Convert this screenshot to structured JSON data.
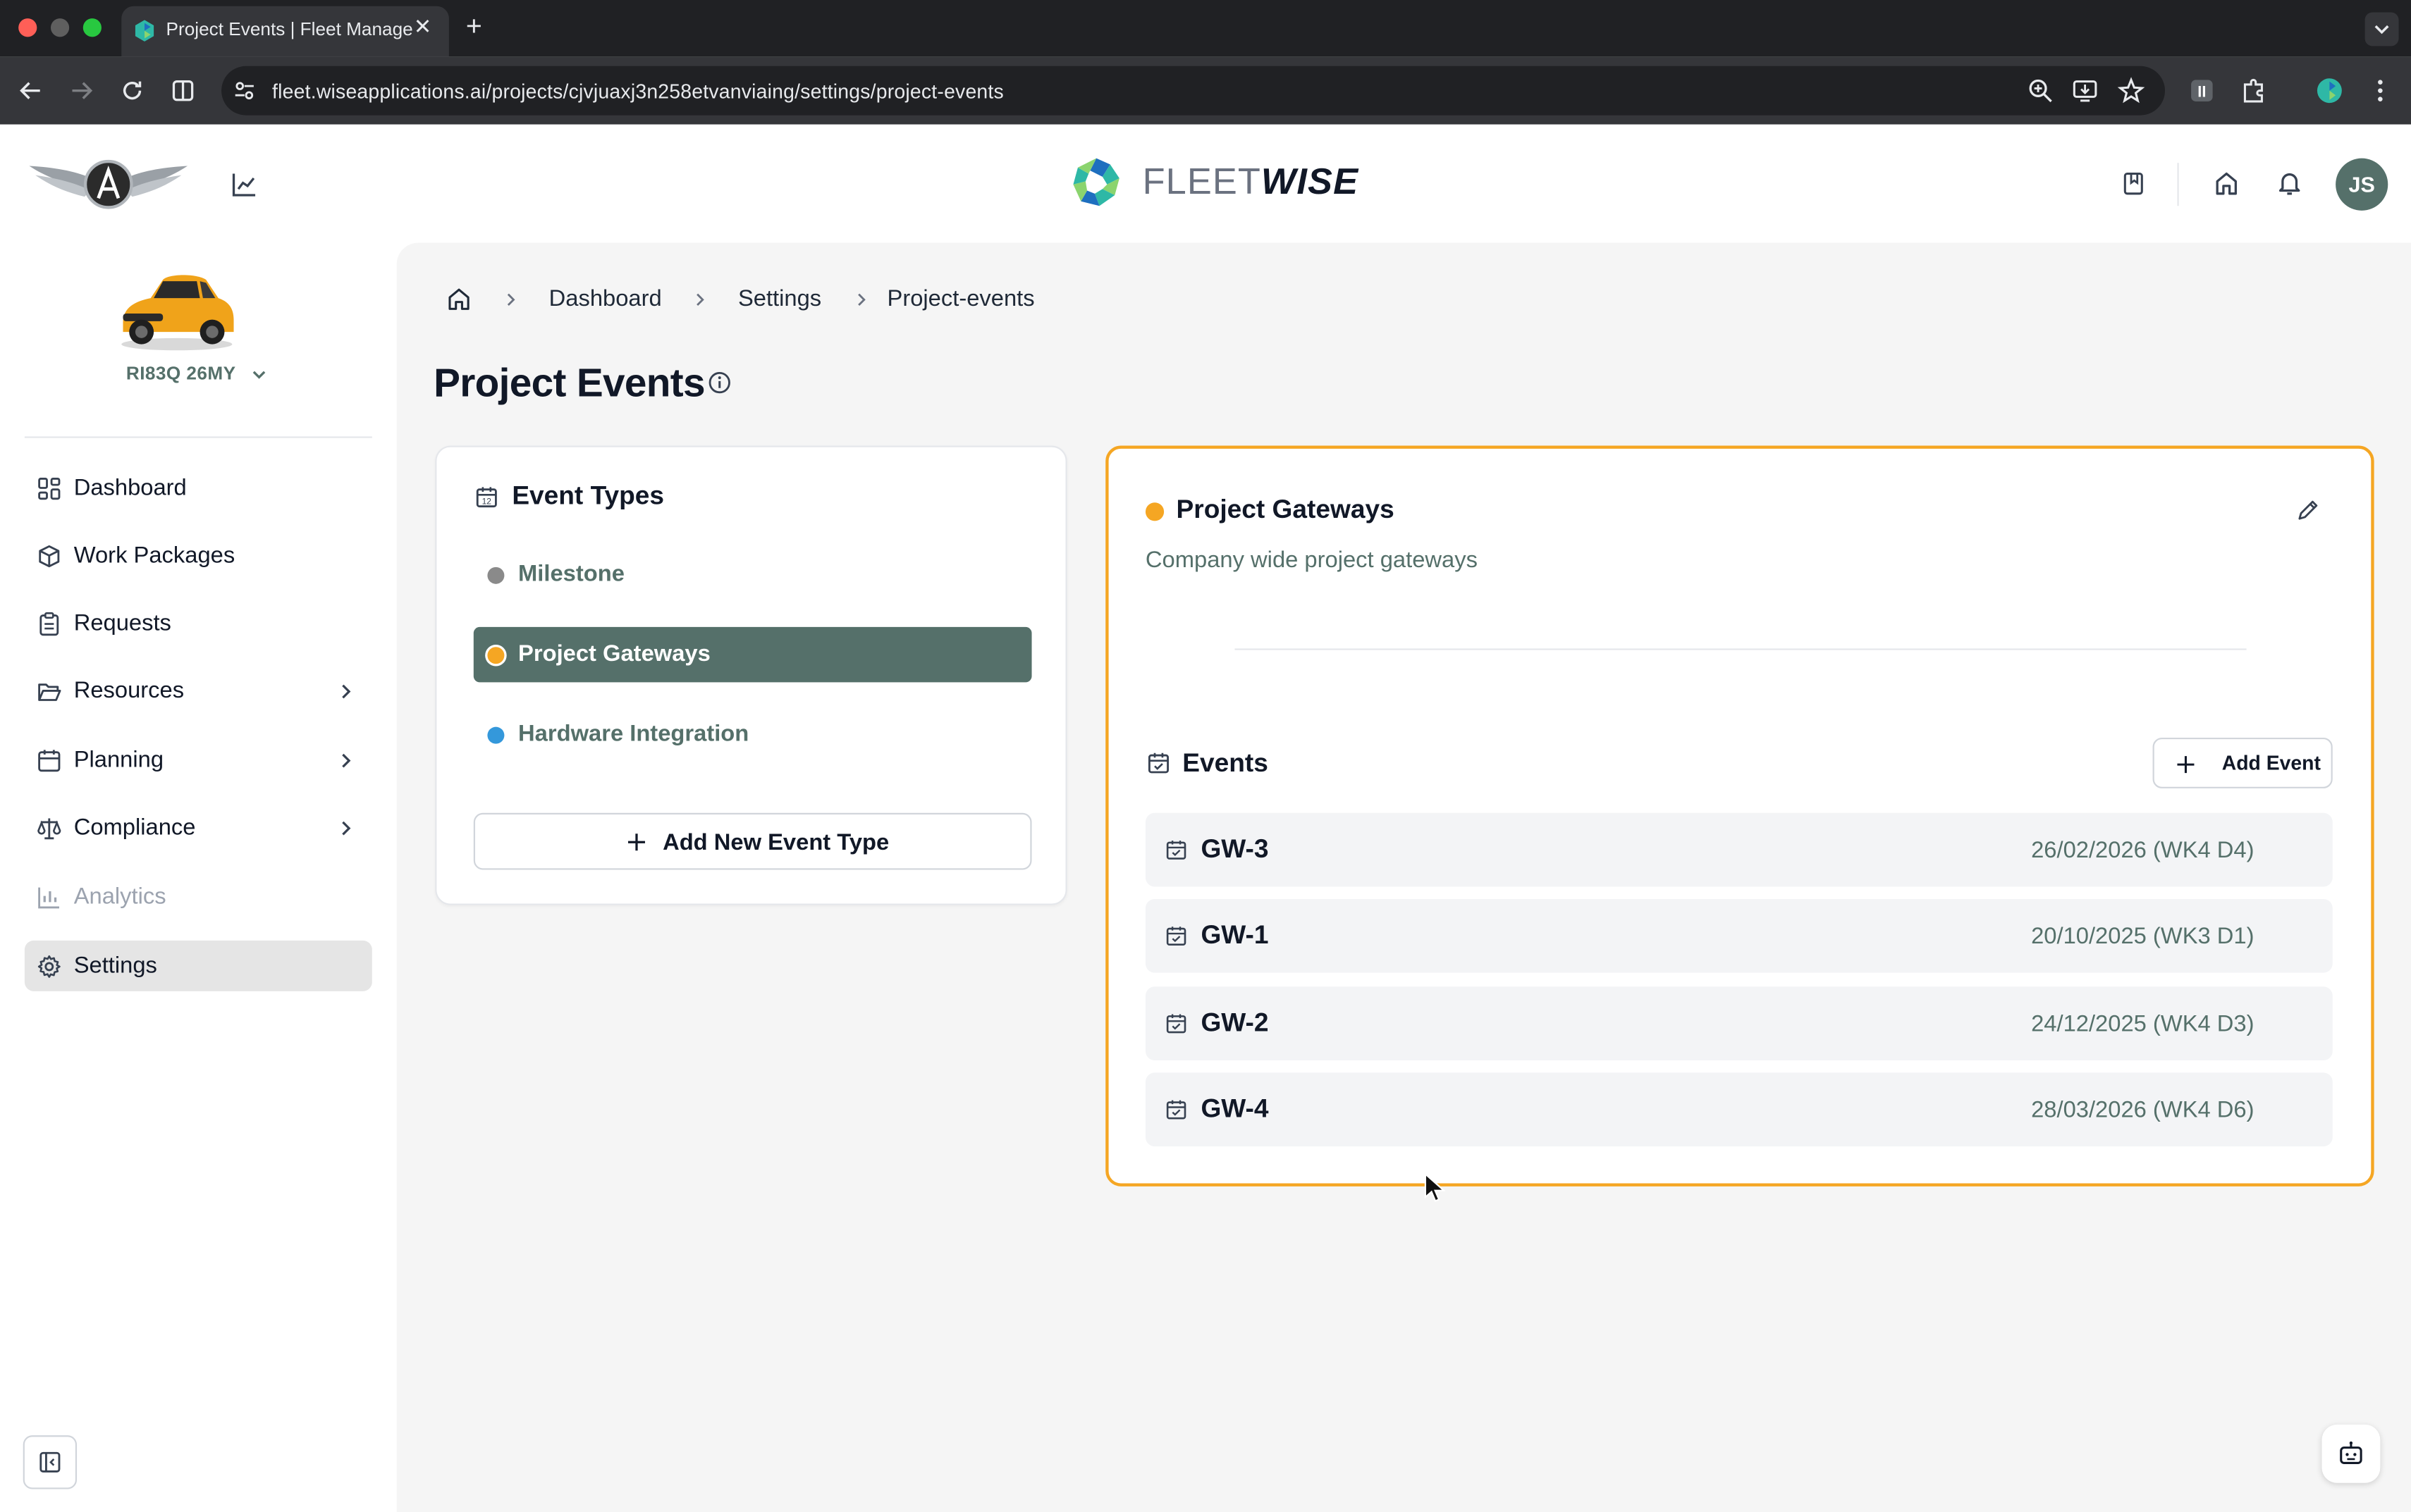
{
  "browser": {
    "tab_title": "Project Events | Fleet Management",
    "url": "fleet.wiseapplications.ai/projects/cjvjuaxj3n258etvanviaing/settings/project-events"
  },
  "header": {
    "brand_light": "FLEET",
    "brand_bold": "WISE",
    "avatar_initials": "JS"
  },
  "sidebar": {
    "vehicle_name": "RI83Q 26MY",
    "items": [
      {
        "label": "Dashboard"
      },
      {
        "label": "Work Packages"
      },
      {
        "label": "Requests"
      },
      {
        "label": "Resources"
      },
      {
        "label": "Planning"
      },
      {
        "label": "Compliance"
      },
      {
        "label": "Analytics"
      },
      {
        "label": "Settings"
      }
    ]
  },
  "breadcrumb": [
    "Dashboard",
    "Settings",
    "Project-events"
  ],
  "page": {
    "title": "Project Events"
  },
  "event_types": {
    "title": "Event Types",
    "items": [
      {
        "label": "Milestone",
        "color": "#8a8a8a"
      },
      {
        "label": "Project Gateways",
        "color": "#f5a623"
      },
      {
        "label": "Hardware Integration",
        "color": "#3498db"
      }
    ],
    "add_label": "Add New Event Type"
  },
  "detail": {
    "title": "Project Gateways",
    "description": "Company wide project gateways",
    "accent_color": "#f5a623",
    "events_title": "Events",
    "add_event_label": "Add Event",
    "events": [
      {
        "name": "GW-3",
        "date": "26/02/2026 (WK4 D4)"
      },
      {
        "name": "GW-1",
        "date": "20/10/2025 (WK3 D1)"
      },
      {
        "name": "GW-2",
        "date": "24/12/2025 (WK4 D3)"
      },
      {
        "name": "GW-4",
        "date": "28/03/2026 (WK4 D6)"
      }
    ]
  },
  "colors": {
    "brand_green": "#55706a",
    "accent_orange": "#f5a623"
  }
}
